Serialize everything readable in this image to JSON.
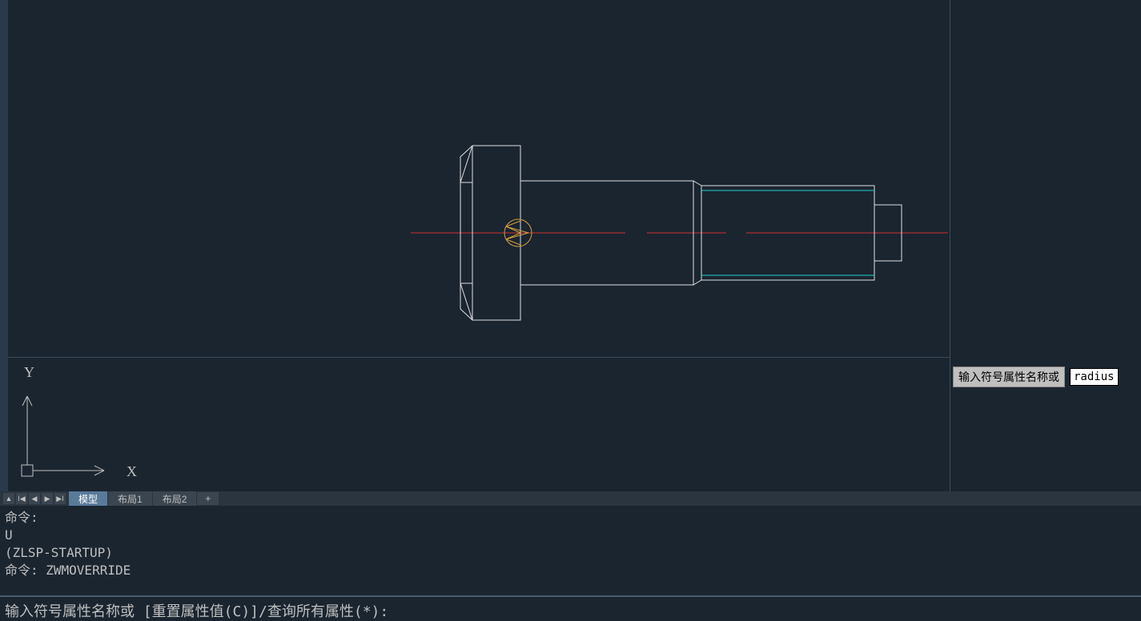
{
  "tabs": {
    "model": "模型",
    "layout1": "布局1",
    "layout2": "布局2",
    "add": "+"
  },
  "ucs": {
    "x": "X",
    "y": "Y"
  },
  "cmd_history": {
    "line1": "命令:",
    "line2": "U",
    "line3": "(ZLSP-STARTUP)",
    "line4": "命令: ZWMOVERRIDE"
  },
  "cmd_prompt": "输入符号属性名称或 [重置属性值(C)]/查询所有属性(*):",
  "tooltip": {
    "label": "输入符号属性名称或",
    "value": "radius"
  },
  "nav": {
    "up": "▲",
    "first": "I◀",
    "prev": "◀",
    "next": "▶",
    "last": "▶I"
  }
}
